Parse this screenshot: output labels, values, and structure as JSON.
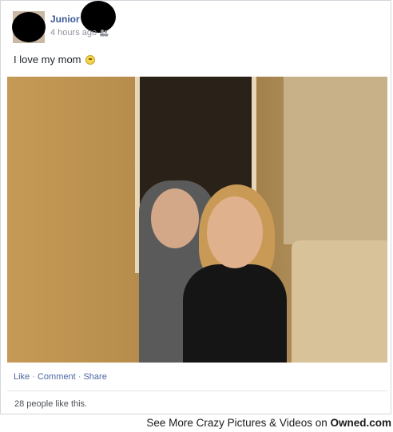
{
  "post": {
    "author_name": "Junior",
    "timestamp": "4 hours ago",
    "status_text": "I love my mom",
    "actions": {
      "like": "Like",
      "comment": "Comment",
      "share": "Share",
      "separator": "·"
    },
    "likes_text": "28 people like this."
  },
  "footer": {
    "text": "See More Crazy Pictures & Videos on ",
    "brand": "Owned.com"
  },
  "icons": {
    "audience": "friends-icon",
    "emoticon": "smiley-icon"
  }
}
